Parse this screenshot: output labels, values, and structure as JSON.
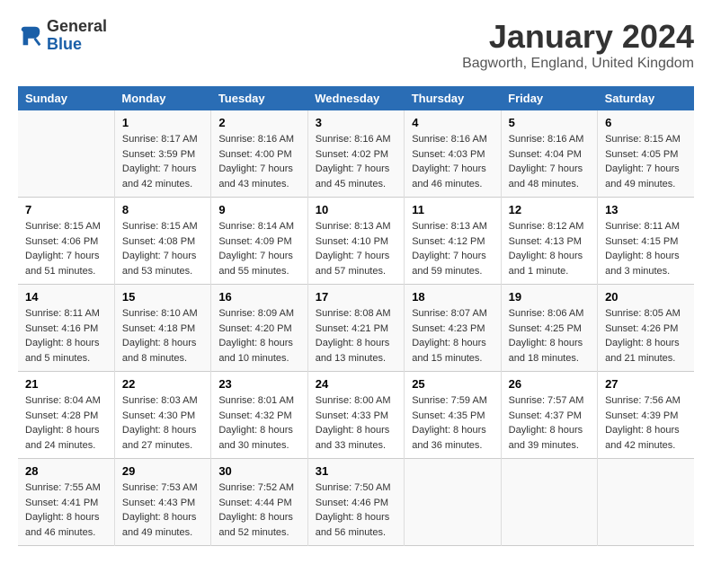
{
  "header": {
    "logo": {
      "line1": "General",
      "line2": "Blue"
    },
    "title": "January 2024",
    "location": "Bagworth, England, United Kingdom"
  },
  "columns": [
    "Sunday",
    "Monday",
    "Tuesday",
    "Wednesday",
    "Thursday",
    "Friday",
    "Saturday"
  ],
  "weeks": [
    [
      {
        "day": "",
        "sunrise": "",
        "sunset": "",
        "daylight": ""
      },
      {
        "day": "1",
        "sunrise": "Sunrise: 8:17 AM",
        "sunset": "Sunset: 3:59 PM",
        "daylight": "Daylight: 7 hours and 42 minutes."
      },
      {
        "day": "2",
        "sunrise": "Sunrise: 8:16 AM",
        "sunset": "Sunset: 4:00 PM",
        "daylight": "Daylight: 7 hours and 43 minutes."
      },
      {
        "day": "3",
        "sunrise": "Sunrise: 8:16 AM",
        "sunset": "Sunset: 4:02 PM",
        "daylight": "Daylight: 7 hours and 45 minutes."
      },
      {
        "day": "4",
        "sunrise": "Sunrise: 8:16 AM",
        "sunset": "Sunset: 4:03 PM",
        "daylight": "Daylight: 7 hours and 46 minutes."
      },
      {
        "day": "5",
        "sunrise": "Sunrise: 8:16 AM",
        "sunset": "Sunset: 4:04 PM",
        "daylight": "Daylight: 7 hours and 48 minutes."
      },
      {
        "day": "6",
        "sunrise": "Sunrise: 8:15 AM",
        "sunset": "Sunset: 4:05 PM",
        "daylight": "Daylight: 7 hours and 49 minutes."
      }
    ],
    [
      {
        "day": "7",
        "sunrise": "Sunrise: 8:15 AM",
        "sunset": "Sunset: 4:06 PM",
        "daylight": "Daylight: 7 hours and 51 minutes."
      },
      {
        "day": "8",
        "sunrise": "Sunrise: 8:15 AM",
        "sunset": "Sunset: 4:08 PM",
        "daylight": "Daylight: 7 hours and 53 minutes."
      },
      {
        "day": "9",
        "sunrise": "Sunrise: 8:14 AM",
        "sunset": "Sunset: 4:09 PM",
        "daylight": "Daylight: 7 hours and 55 minutes."
      },
      {
        "day": "10",
        "sunrise": "Sunrise: 8:13 AM",
        "sunset": "Sunset: 4:10 PM",
        "daylight": "Daylight: 7 hours and 57 minutes."
      },
      {
        "day": "11",
        "sunrise": "Sunrise: 8:13 AM",
        "sunset": "Sunset: 4:12 PM",
        "daylight": "Daylight: 7 hours and 59 minutes."
      },
      {
        "day": "12",
        "sunrise": "Sunrise: 8:12 AM",
        "sunset": "Sunset: 4:13 PM",
        "daylight": "Daylight: 8 hours and 1 minute."
      },
      {
        "day": "13",
        "sunrise": "Sunrise: 8:11 AM",
        "sunset": "Sunset: 4:15 PM",
        "daylight": "Daylight: 8 hours and 3 minutes."
      }
    ],
    [
      {
        "day": "14",
        "sunrise": "Sunrise: 8:11 AM",
        "sunset": "Sunset: 4:16 PM",
        "daylight": "Daylight: 8 hours and 5 minutes."
      },
      {
        "day": "15",
        "sunrise": "Sunrise: 8:10 AM",
        "sunset": "Sunset: 4:18 PM",
        "daylight": "Daylight: 8 hours and 8 minutes."
      },
      {
        "day": "16",
        "sunrise": "Sunrise: 8:09 AM",
        "sunset": "Sunset: 4:20 PM",
        "daylight": "Daylight: 8 hours and 10 minutes."
      },
      {
        "day": "17",
        "sunrise": "Sunrise: 8:08 AM",
        "sunset": "Sunset: 4:21 PM",
        "daylight": "Daylight: 8 hours and 13 minutes."
      },
      {
        "day": "18",
        "sunrise": "Sunrise: 8:07 AM",
        "sunset": "Sunset: 4:23 PM",
        "daylight": "Daylight: 8 hours and 15 minutes."
      },
      {
        "day": "19",
        "sunrise": "Sunrise: 8:06 AM",
        "sunset": "Sunset: 4:25 PM",
        "daylight": "Daylight: 8 hours and 18 minutes."
      },
      {
        "day": "20",
        "sunrise": "Sunrise: 8:05 AM",
        "sunset": "Sunset: 4:26 PM",
        "daylight": "Daylight: 8 hours and 21 minutes."
      }
    ],
    [
      {
        "day": "21",
        "sunrise": "Sunrise: 8:04 AM",
        "sunset": "Sunset: 4:28 PM",
        "daylight": "Daylight: 8 hours and 24 minutes."
      },
      {
        "day": "22",
        "sunrise": "Sunrise: 8:03 AM",
        "sunset": "Sunset: 4:30 PM",
        "daylight": "Daylight: 8 hours and 27 minutes."
      },
      {
        "day": "23",
        "sunrise": "Sunrise: 8:01 AM",
        "sunset": "Sunset: 4:32 PM",
        "daylight": "Daylight: 8 hours and 30 minutes."
      },
      {
        "day": "24",
        "sunrise": "Sunrise: 8:00 AM",
        "sunset": "Sunset: 4:33 PM",
        "daylight": "Daylight: 8 hours and 33 minutes."
      },
      {
        "day": "25",
        "sunrise": "Sunrise: 7:59 AM",
        "sunset": "Sunset: 4:35 PM",
        "daylight": "Daylight: 8 hours and 36 minutes."
      },
      {
        "day": "26",
        "sunrise": "Sunrise: 7:57 AM",
        "sunset": "Sunset: 4:37 PM",
        "daylight": "Daylight: 8 hours and 39 minutes."
      },
      {
        "day": "27",
        "sunrise": "Sunrise: 7:56 AM",
        "sunset": "Sunset: 4:39 PM",
        "daylight": "Daylight: 8 hours and 42 minutes."
      }
    ],
    [
      {
        "day": "28",
        "sunrise": "Sunrise: 7:55 AM",
        "sunset": "Sunset: 4:41 PM",
        "daylight": "Daylight: 8 hours and 46 minutes."
      },
      {
        "day": "29",
        "sunrise": "Sunrise: 7:53 AM",
        "sunset": "Sunset: 4:43 PM",
        "daylight": "Daylight: 8 hours and 49 minutes."
      },
      {
        "day": "30",
        "sunrise": "Sunrise: 7:52 AM",
        "sunset": "Sunset: 4:44 PM",
        "daylight": "Daylight: 8 hours and 52 minutes."
      },
      {
        "day": "31",
        "sunrise": "Sunrise: 7:50 AM",
        "sunset": "Sunset: 4:46 PM",
        "daylight": "Daylight: 8 hours and 56 minutes."
      },
      {
        "day": "",
        "sunrise": "",
        "sunset": "",
        "daylight": ""
      },
      {
        "day": "",
        "sunrise": "",
        "sunset": "",
        "daylight": ""
      },
      {
        "day": "",
        "sunrise": "",
        "sunset": "",
        "daylight": ""
      }
    ]
  ]
}
